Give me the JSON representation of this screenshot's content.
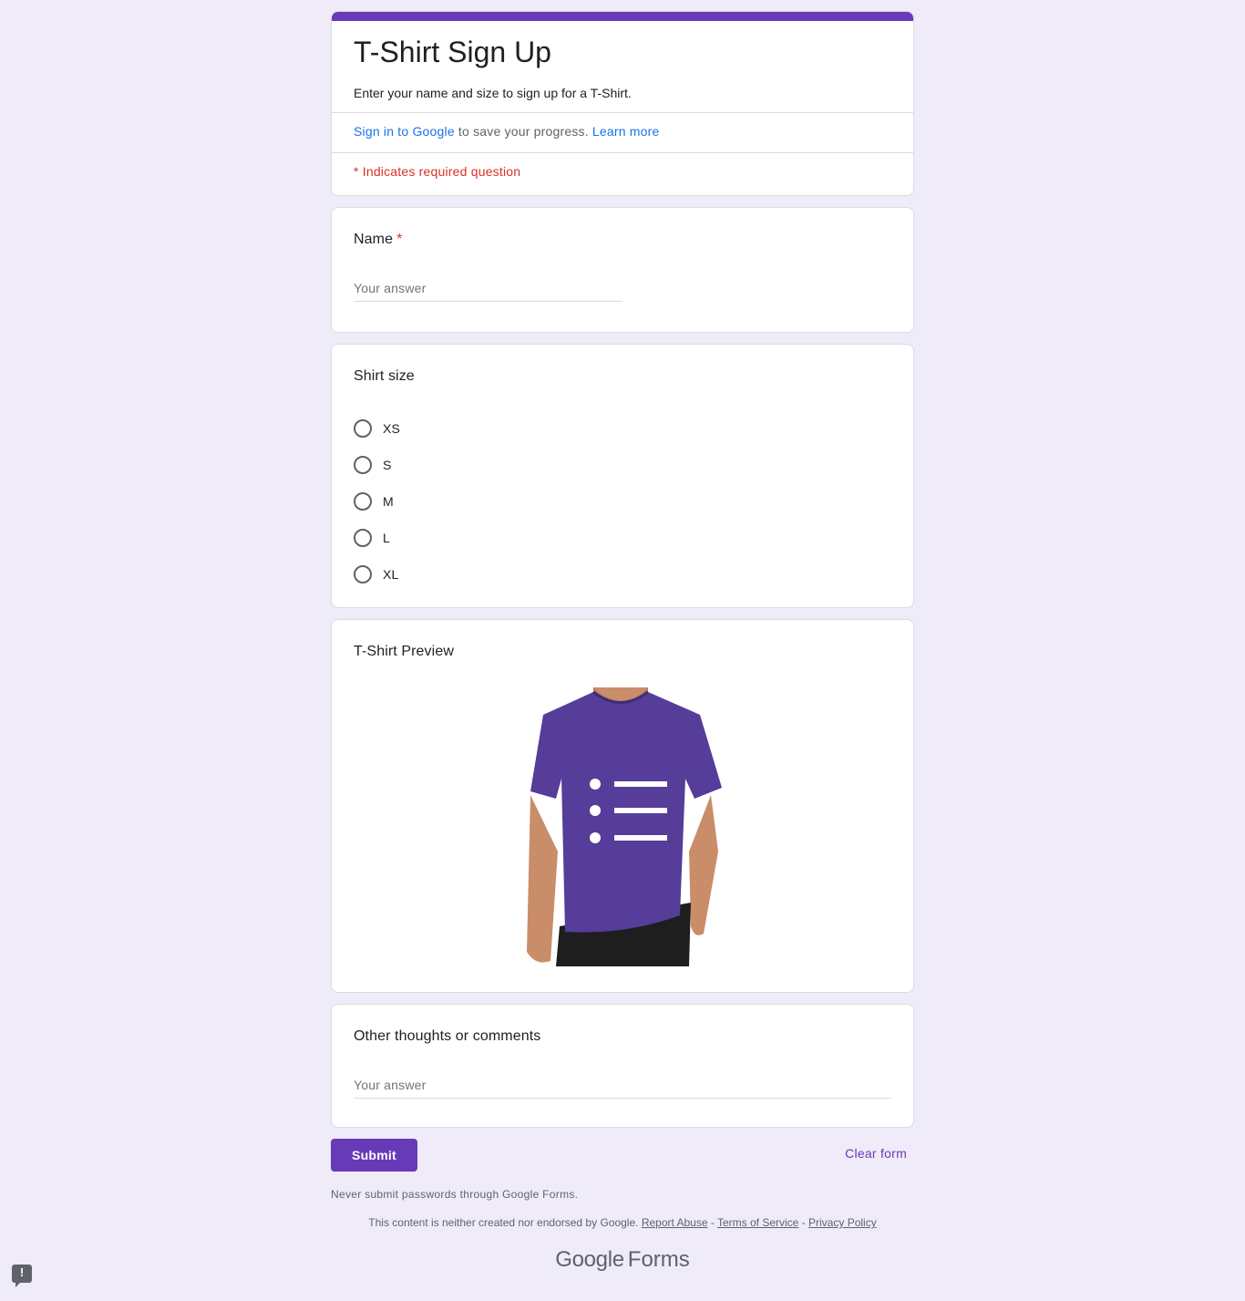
{
  "form": {
    "title": "T-Shirt Sign Up",
    "description": "Enter your name and size to sign up for a T-Shirt.",
    "signin_link": "Sign in to Google",
    "signin_text": " to save your progress. ",
    "learn_more": "Learn more",
    "required_note": "* Indicates required question",
    "accent_color": "#673ab7"
  },
  "questions": {
    "name": {
      "title": "Name",
      "required_mark": "*",
      "placeholder": "Your answer"
    },
    "size": {
      "title": "Shirt size",
      "options": [
        "XS",
        "S",
        "M",
        "L",
        "XL"
      ]
    },
    "preview": {
      "title": "T-Shirt Preview",
      "image_icon": "tshirt-preview-image"
    },
    "comments": {
      "title": "Other thoughts or comments",
      "placeholder": "Your answer"
    }
  },
  "actions": {
    "submit": "Submit",
    "clear": "Clear form"
  },
  "footer": {
    "password_note": "Never submit passwords through Google Forms.",
    "disclaimer": "This content is neither created nor endorsed by Google. ",
    "report_abuse": "Report Abuse",
    "terms": "Terms of Service",
    "privacy": "Privacy Policy",
    "sep": " - ",
    "brand_google": "Google",
    "brand_forms": "Forms"
  },
  "report_button": {
    "icon": "report-problem-icon",
    "glyph": "!"
  }
}
